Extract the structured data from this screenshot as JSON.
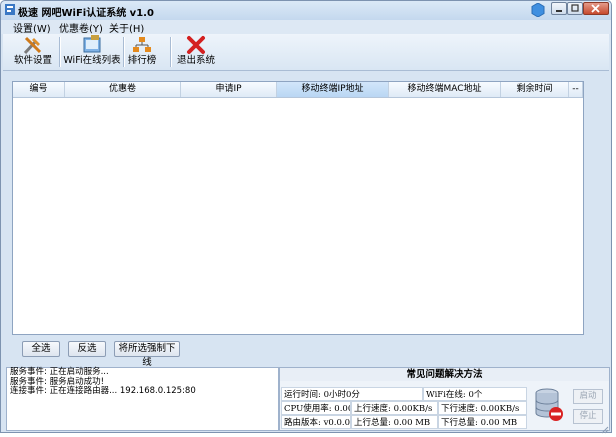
{
  "window": {
    "title": "极速 网吧WiFi认证系统 v1.0"
  },
  "menu": [
    {
      "label": "设置(W)"
    },
    {
      "label": "优惠卷(Y)"
    },
    {
      "label": "关于(H)"
    }
  ],
  "toolbar": [
    {
      "label": "软件设置",
      "icon": "tools-icon"
    },
    {
      "label": "WiFi在线列表",
      "icon": "device-list-icon"
    },
    {
      "label": "排行榜",
      "icon": "ranking-icon"
    },
    {
      "label": "退出系统",
      "icon": "red-x-icon"
    }
  ],
  "table": {
    "columns": [
      "编号",
      "优惠卷",
      "申请IP",
      "移动终端IP地址",
      "移动终端MAC地址",
      "剩余时间",
      "--"
    ],
    "rows": []
  },
  "buttons": {
    "select_all": "全选",
    "invert": "反选",
    "force_offline": "将所选强制下线"
  },
  "log": [
    "服务事件: 正在启动服务...",
    "服务事件: 服务启动成功!",
    "连接事件: 正在连接路由器...   192.168.0.125:80"
  ],
  "faq": {
    "title": "常见问题解决方法"
  },
  "stats": {
    "run_time": "运行时间: 0小时0分",
    "wifi_online": "WiFi在线: 0个",
    "cpu": "CPU使用率: 0.00%",
    "up_speed": "上行速度: 0.00KB/s",
    "down_speed": "下行速度: 0.00KB/s",
    "router_version": "路由版本: v0.0.0",
    "up_total": "上行总量: 0.00 MB",
    "down_total": "下行总量: 0.00 MB"
  },
  "service": {
    "start": "启动",
    "stop": "停止"
  }
}
